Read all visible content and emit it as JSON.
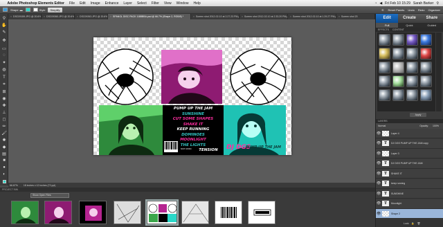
{
  "menubar": {
    "apple": "",
    "app": "Adobe Photoshop Elements Editor",
    "items": [
      "File",
      "Edit",
      "Image",
      "Enhance",
      "Layer",
      "Select",
      "Filter",
      "View",
      "Window",
      "Help"
    ],
    "clock": "Fri Feb 10  15:29",
    "user": "Sarah Barker"
  },
  "options": {
    "shape_label": "Shape",
    "style_label": "Style",
    "simplify": "Simplify",
    "reset_panels": "Reset Panels",
    "undo": "Undo",
    "redo": "Redo",
    "organizer": "Organizer"
  },
  "tabs": [
    {
      "label": "DSC09159.JPG @ 20.6% (...",
      "active": false
    },
    {
      "label": "DSC09260.JPG @ 20.6% (...",
      "active": false
    },
    {
      "label": "DSC09263.JPG @ 20.6% (...",
      "active": false
    },
    {
      "label": "SPANGL DISC PACK 1188BBA.psd @ 66.7% (Shape 2, RGB/8) *",
      "active": true
    },
    {
      "label": "Screen shot 2012-02-10 at 2.27.23 PM.png",
      "active": false
    },
    {
      "label": "Screen shot 2012-02-10 at 2.33.20 PM.png",
      "active": false
    },
    {
      "label": "Screen shot 2012-02-10 at 1.29.27 PM.png",
      "active": false
    },
    {
      "label": "Screen shot 20",
      "active": false
    }
  ],
  "doc_text_lines": [
    {
      "text": "PUMP UP THE JAM",
      "color": "#ffffff"
    },
    {
      "text": "SUNSHINE",
      "color": "#35c3c3"
    },
    {
      "text": "CUT SOME SHAPES",
      "color": "#ff2ea0"
    },
    {
      "text": "SHAKE IT",
      "color": "#ff2ea0"
    },
    {
      "text": "KEEP RUNNING",
      "color": "#ffffff"
    },
    {
      "text": "DOMINOES",
      "color": "#35c3c3"
    },
    {
      "text": "MOONLIGHT",
      "color": "#ff2ea0"
    },
    {
      "text": "THE LIGHTS",
      "color": "#35c3c3"
    },
    {
      "text": "TENSION",
      "color": "#ffffff"
    }
  ],
  "cover_title": "DJ DGS",
  "cover_subtitle": "PUMP UP THE JAM",
  "barcode_text": "5 012345 678900",
  "label_text": "SONY MUSIC",
  "status": {
    "zoom": "66.67%",
    "size": "18 inches x 12 inches (72 ppi)"
  },
  "project_bin": {
    "header": "PROJECT BIN",
    "select": "Show Open Files"
  },
  "panel": {
    "modes": [
      "Edit",
      "Create",
      "Share"
    ],
    "subtabs": [
      "Full",
      "Quick",
      "Guided"
    ],
    "effects_header": [
      "EFFECTS",
      "CONTENT"
    ],
    "apply": "Apply",
    "layers_header": "LAYERS",
    "blend": "Normal",
    "opacity_label": "Opacity:",
    "opacity": "100%",
    "lock": "Lock:",
    "layers": [
      {
        "name": "Layer 4",
        "type": "img",
        "selected": false
      },
      {
        "name": "DJ DGS PUMP UP THE JAM copy",
        "type": "text",
        "selected": false
      },
      {
        "name": "Layer 3",
        "type": "img",
        "selected": false
      },
      {
        "name": "DJ DGS PUMP UP THE JAM",
        "type": "text",
        "selected": false
      },
      {
        "name": "SHAKE IT",
        "type": "text",
        "selected": false
      },
      {
        "name": "keep running",
        "type": "text",
        "selected": false
      },
      {
        "name": "SUNSHINE",
        "type": "text",
        "selected": false
      },
      {
        "name": "Moonlight",
        "type": "text",
        "selected": false
      },
      {
        "name": "Shape 2",
        "type": "img",
        "selected": true
      }
    ]
  },
  "colors": {
    "accent": "#1e6fc4",
    "green": "#3aa64a",
    "magenta": "#b52490",
    "cyan": "#2ad8c8"
  }
}
